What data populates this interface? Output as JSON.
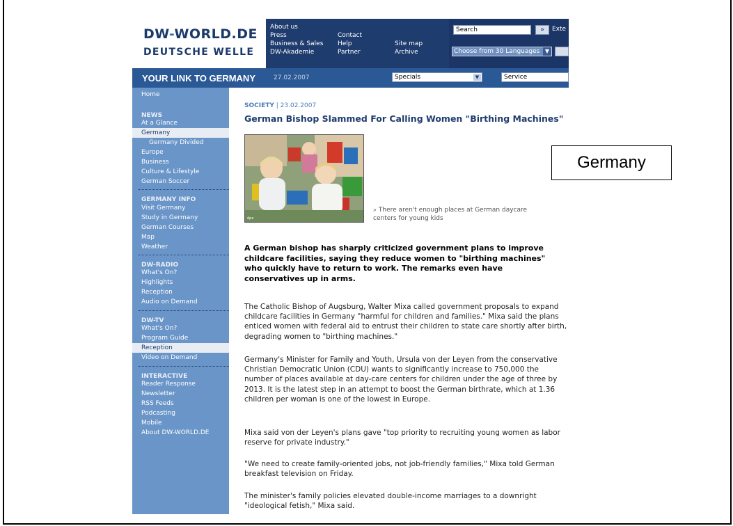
{
  "logo": {
    "part1": "DW",
    "dash": "-",
    "part2": "WORLD.DE",
    "subtitle": "DEUTSCHE WELLE"
  },
  "top_nav": {
    "col1": [
      "About us",
      "Press",
      "Business & Sales",
      "DW-Akademie"
    ],
    "col2": [
      "Contact",
      "Help",
      "Partner"
    ],
    "col3": [
      "Site map",
      "Archive"
    ]
  },
  "search": {
    "value": "Search",
    "go": "»",
    "extended": "Exte",
    "languages": "Choose from 30 Languages"
  },
  "strip": {
    "title": "YOUR LINK TO GERMANY",
    "date": "27.02.2007",
    "specials": "Specials",
    "service": "Service"
  },
  "sidebar": {
    "home": "Home",
    "news_head": "NEWS",
    "news": [
      "At a Glance",
      "Germany",
      "Germany Divided",
      "Europe",
      "Business",
      "Culture & Lifestyle",
      "German Soccer"
    ],
    "info_head": "GERMANY INFO",
    "info": [
      "Visit Germany",
      "Study in Germany",
      "German Courses",
      "Map",
      "Weather"
    ],
    "radio_head": "DW-RADIO",
    "radio": [
      "What's On?",
      "Highlights",
      "Reception",
      "Audio on Demand"
    ],
    "tv_head": "DW-TV",
    "tv": [
      "What's On?",
      "Program Guide",
      "Reception",
      "Video on Demand"
    ],
    "interactive_head": "INTERACTIVE",
    "interactive": [
      "Reader Response",
      "Newsletter",
      "RSS Feeds",
      "Podcasting",
      "Mobile",
      "About DW-WORLD.DE"
    ]
  },
  "article": {
    "section": "SOCIETY",
    "date": "| 23.02.2007",
    "headline": "German Bishop Slammed For Calling Women \"Birthing Machines\"",
    "photo_credit": "dpa",
    "caption": "There aren't enough places at German daycare centers for young kids",
    "lead": "A German bishop has sharply criticized government plans to improve childcare facilities, saying they reduce women to \"birthing machines\" who quickly have to return to work. The remarks even have conservatives up in arms.",
    "paragraphs": [
      "The Catholic Bishop of Augsburg, Walter Mixa called government proposals to expand childcare facilities in Germany \"harmful for children and families.\" Mixa said the plans enticed women with federal aid to entrust their children to state care shortly after birth, degrading women to \"birthing machines.\"",
      "Germany's Minister for Family and Youth, Ursula von der Leyen from the conservative Christian Democratic Union (CDU) wants to significantly increase to 750,000 the number of places available at day-care centers for children under the age of three by 2013. It is the latest step in an attempt to boost the German birthrate, which at 1.36 children per woman is one of the lowest in Europe.",
      "Mixa said von der Leyen's plans gave \"top priority to recruiting young women as labor reserve for private industry.\"",
      "\"We need to create family-oriented jobs, not job-friendly families,\" Mixa told German breakfast television on Friday.",
      "The minister's family policies elevated double-income marriages to a downright \"ideological fetish,\" Mixa said."
    ]
  },
  "annotation_label": "Germany"
}
